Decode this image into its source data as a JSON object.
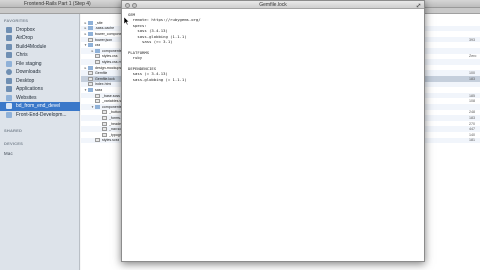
{
  "finder": {
    "title": "Frontend-Rails Part 1 (Step 4)",
    "sidebar": {
      "favorites_heading": "FAVORITES",
      "shared_heading": "SHARED",
      "devices_heading": "DEVICES",
      "devices_item": "Mac",
      "items": [
        {
          "label": "Dropbox"
        },
        {
          "label": "AirDrop"
        },
        {
          "label": "Build4Module"
        },
        {
          "label": "Chris"
        },
        {
          "label": "File staging"
        },
        {
          "label": "Downloads"
        },
        {
          "label": "Desktop"
        },
        {
          "label": "Applications"
        },
        {
          "label": "Websites"
        },
        {
          "label": "bd_from_end_devel"
        },
        {
          "label": "Front-End-Developm..."
        }
      ]
    },
    "files": [
      {
        "name": "_site",
        "indent": 0,
        "tri": "▸",
        "type": "folder"
      },
      {
        "name": ".sass-cache",
        "indent": 0,
        "tri": "▸",
        "type": "folder"
      },
      {
        "name": "bower_components",
        "indent": 0,
        "tri": "▸",
        "type": "folder"
      },
      {
        "name": "bower.json",
        "indent": 0,
        "tri": "",
        "type": "file"
      },
      {
        "name": "css",
        "indent": 0,
        "tri": "▾",
        "type": "folder"
      },
      {
        "name": "components",
        "indent": 1,
        "tri": "▸",
        "type": "folder"
      },
      {
        "name": "styles.css",
        "indent": 1,
        "tri": "",
        "type": "file"
      },
      {
        "name": "styles.css.map",
        "indent": 1,
        "tri": "",
        "type": "file"
      },
      {
        "name": "design-mockups",
        "indent": 0,
        "tri": "▸",
        "type": "folder"
      },
      {
        "name": "Gemfile",
        "indent": 0,
        "tri": "",
        "type": "file"
      },
      {
        "name": "Gemfile.lock",
        "indent": 0,
        "tri": "",
        "type": "file"
      },
      {
        "name": "index.html",
        "indent": 0,
        "tri": "",
        "type": "file"
      },
      {
        "name": "sass",
        "indent": 0,
        "tri": "▾",
        "type": "folder"
      },
      {
        "name": "_base.scss",
        "indent": 1,
        "tri": "",
        "type": "file"
      },
      {
        "name": "_variables.scss",
        "indent": 1,
        "tri": "",
        "type": "file"
      },
      {
        "name": "components",
        "indent": 1,
        "tri": "▾",
        "type": "folder"
      },
      {
        "name": "_buttons.scss",
        "indent": 2,
        "tri": "",
        "type": "file"
      },
      {
        "name": "_forms.scss",
        "indent": 2,
        "tri": "",
        "type": "file"
      },
      {
        "name": "_header.scss",
        "indent": 2,
        "tri": "",
        "type": "file"
      },
      {
        "name": "_nav.scss",
        "indent": 2,
        "tri": "",
        "type": "file"
      },
      {
        "name": "_typography.scss",
        "indent": 2,
        "tri": "",
        "type": "file"
      },
      {
        "name": "styles.scss",
        "indent": 1,
        "tri": "",
        "type": "file"
      }
    ],
    "sizes": [
      "",
      "",
      "",
      "393",
      "",
      "",
      "Zero",
      "",
      "",
      "100",
      "183",
      "",
      "",
      "185",
      "108",
      "",
      "248",
      "183",
      "270",
      "447",
      "140",
      "181"
    ]
  },
  "editor": {
    "title": "Gemfile.lock",
    "lines": [
      "GEM",
      "  remote: https://rubygems.org/",
      "  specs:",
      "    sass (3.4.13)",
      "    sass-globbing (1.1.1)",
      "      sass (>= 3.1)",
      "",
      "PLATFORMS",
      "  ruby",
      "",
      "DEPENDENCIES",
      "  sass (= 3.4.13)",
      "  sass-globbing (= 1.1.1)"
    ]
  }
}
